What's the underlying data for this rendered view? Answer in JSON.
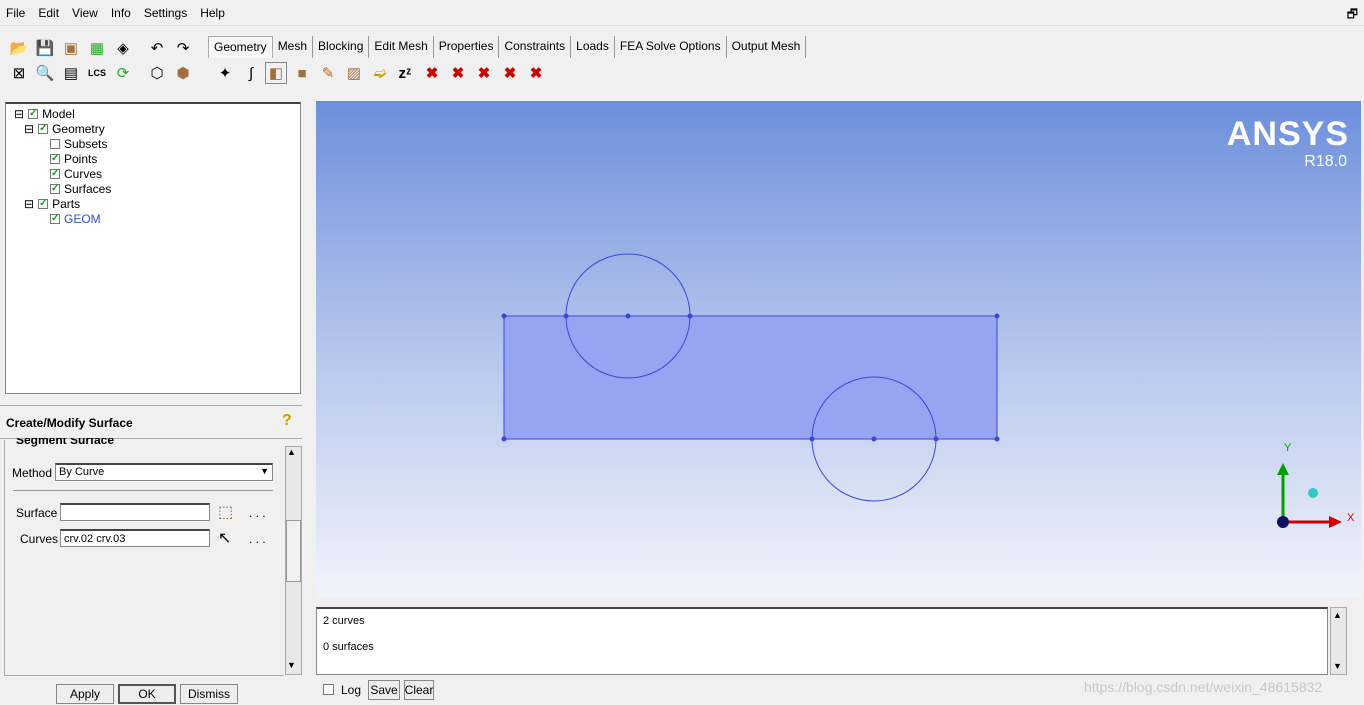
{
  "menu": [
    "File",
    "Edit",
    "View",
    "Info",
    "Settings",
    "Help"
  ],
  "tabs": [
    "Geometry",
    "Mesh",
    "Blocking",
    "Edit Mesh",
    "Properties",
    "Constraints",
    "Loads",
    "FEA Solve Options",
    "Output Mesh"
  ],
  "tree": [
    {
      "label": "Model"
    },
    {
      "label": "Geometry"
    },
    {
      "label": "Subsets"
    },
    {
      "label": "Points"
    },
    {
      "label": "Curves"
    },
    {
      "label": "Surfaces"
    },
    {
      "label": "Parts"
    },
    {
      "label": "GEOM"
    }
  ],
  "panel": {
    "title": "Create/Modify Surface",
    "section": "Segment Surface",
    "method_label": "Method",
    "method_value": "By Curve",
    "surface_label": "Surface",
    "surface_value": "",
    "curves_label": "Curves",
    "curves_value": "crv.02 crv.03",
    "dots": ". . .",
    "apply": "Apply",
    "ok": "OK",
    "dismiss": "Dismiss"
  },
  "viewport": {
    "brand": "ANSYS",
    "version": "R18.0",
    "axis_x": "X",
    "axis_y": "Y"
  },
  "log": {
    "lines": [
      "2 curves",
      "0 surfaces"
    ],
    "log_label": "Log",
    "save": "Save",
    "clear": "Clear"
  },
  "watermark": "https://blog.csdn.net/weixin_48615832",
  "colors": {
    "surface": "#97a4f2",
    "edge": "#3a48d8",
    "axis_x": "#d00000",
    "axis_y": "#00a000"
  }
}
